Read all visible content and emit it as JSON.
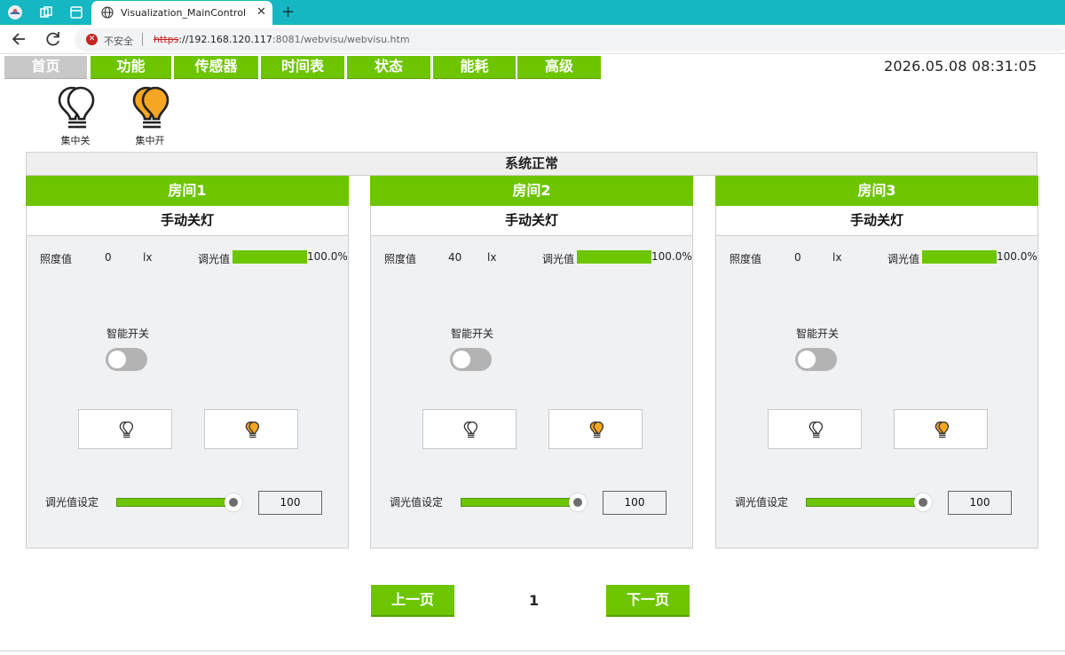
{
  "browser": {
    "tab_title": "Visualization_MainControl",
    "security_label": "不安全",
    "url_scheme": "https",
    "url_host": "://192.168.120.117",
    "url_rest": ":8081/webvisu/webvisu.htm"
  },
  "menu": {
    "items": [
      {
        "label": "首页",
        "active": true
      },
      {
        "label": "功能",
        "active": false
      },
      {
        "label": "传感器",
        "active": false
      },
      {
        "label": "时间表",
        "active": false
      },
      {
        "label": "状态",
        "active": false
      },
      {
        "label": "能耗",
        "active": false
      },
      {
        "label": "高级",
        "active": false
      }
    ]
  },
  "datetime": "2026.05.08 08:31:05",
  "master": {
    "off_label": "集中关",
    "on_label": "集中开"
  },
  "status": "系统正常",
  "rooms": [
    {
      "name": "房间1",
      "mode": "手动关灯",
      "lux_label": "照度值",
      "lux_value": "0",
      "lux_unit": "lx",
      "dim_label": "调光值",
      "dim_percent_text": "100.0%",
      "dim_level": 1.0,
      "smart_switch_label": "智能开关",
      "smart_switch_on": false,
      "dim_set_label": "调光值设定",
      "slider_value": 100,
      "dim_set_value": "100"
    },
    {
      "name": "房间2",
      "mode": "手动关灯",
      "lux_label": "照度值",
      "lux_value": "40",
      "lux_unit": "lx",
      "dim_label": "调光值",
      "dim_percent_text": "100.0%",
      "dim_level": 1.0,
      "smart_switch_label": "智能开关",
      "smart_switch_on": false,
      "dim_set_label": "调光值设定",
      "slider_value": 100,
      "dim_set_value": "100"
    },
    {
      "name": "房间3",
      "mode": "手动关灯",
      "lux_label": "照度值",
      "lux_value": "0",
      "lux_unit": "lx",
      "dim_label": "调光值",
      "dim_percent_text": "100.0%",
      "dim_level": 1.0,
      "smart_switch_label": "智能开关",
      "smart_switch_on": false,
      "dim_set_label": "调光值设定",
      "slider_value": 100,
      "dim_set_value": "100"
    }
  ],
  "pagination": {
    "prev_label": "上一页",
    "page": "1",
    "next_label": "下一页"
  },
  "colors": {
    "accent_green": "#6dc500",
    "browser_teal": "#14b7c2",
    "bulb_on": "#f5a623"
  },
  "icons": [
    "app-logo-icon",
    "workspaces-icon",
    "tab-overview-icon",
    "globe-icon",
    "back-icon",
    "reload-icon",
    "insecure-icon",
    "bulb-off-icon",
    "bulb-on-icon"
  ]
}
